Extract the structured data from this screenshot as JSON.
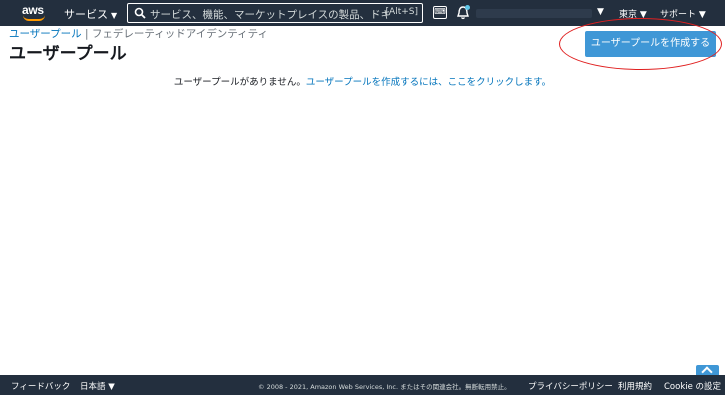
{
  "header": {
    "logo_text": "aws",
    "services_label": "サービス",
    "search_placeholder": "サービス、機能、マーケットプレイスの製品、ドキュメント",
    "search_shortcut": "[Alt+S]",
    "cloudshell_glyph": "⌨",
    "region_label": "東京 ▼",
    "support_label": "サポート ▼",
    "account_caret": "▼"
  },
  "breadcrumb": {
    "active": "ユーザープール",
    "separator": " | ",
    "inactive": "フェデレーティッドアイデンティティ"
  },
  "page": {
    "title": "ユーザープール",
    "create_button": "ユーザープールを作成する",
    "empty_text": "ユーザープールがありません。",
    "empty_link": "ユーザープールを作成するには、ここをクリックします。"
  },
  "footer": {
    "feedback": "フィードバック",
    "language": "日本語 ▼",
    "copyright": "© 2008 - 2021, Amazon Web Services, Inc. またはその関連会社。無断転用禁止。",
    "privacy": "プライバシーポリシー",
    "terms": "利用規約",
    "cookie": "Cookie の設定"
  },
  "colors": {
    "nav_bg": "#232f3e",
    "primary_button": "#3f97d6",
    "link": "#0073bb",
    "annotation": "#e02020",
    "aws_smile": "#ff9900"
  }
}
